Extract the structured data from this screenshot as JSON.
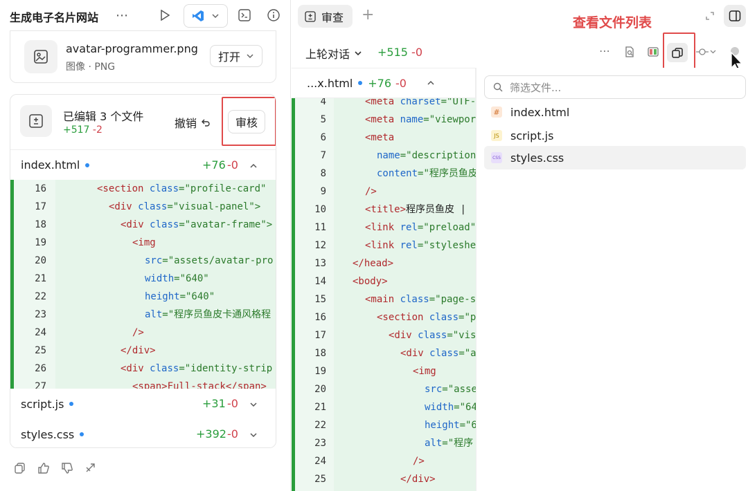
{
  "left": {
    "title": "生成电子名片网站",
    "image_card": {
      "filename": "avatar-programmer.png",
      "meta": "图像 · PNG",
      "open_label": "打开"
    },
    "edit_card": {
      "title": "已编辑 3 个文件",
      "added": "+517",
      "removed": "-2",
      "undo_label": "撤销",
      "review_label": "审核"
    },
    "files": [
      {
        "name": "index.html",
        "added": "+76",
        "removed": "-0"
      },
      {
        "name": "script.js",
        "added": "+31",
        "removed": "-0"
      },
      {
        "name": "styles.css",
        "added": "+392",
        "removed": "-0"
      }
    ],
    "code_lines": [
      {
        "n": "16",
        "indent": 3,
        "html": "section-profile"
      },
      {
        "n": "17"
      },
      {
        "n": "18"
      },
      {
        "n": "19"
      },
      {
        "n": "20"
      },
      {
        "n": "21"
      },
      {
        "n": "22"
      },
      {
        "n": "23"
      },
      {
        "n": "24"
      },
      {
        "n": "25"
      },
      {
        "n": "26"
      },
      {
        "n": "27"
      }
    ],
    "code_text": {
      "l16a": "<section ",
      "l16b": "class",
      "l16c": "=\"profile-card\"",
      "l17a": "<div ",
      "l17b": "class",
      "l17c": "=\"visual-panel\">",
      "l18a": "<div ",
      "l18b": "class",
      "l18c": "=\"avatar-frame\">",
      "l19a": "<img",
      "l20a": "src",
      "l20b": "=\"assets/avatar-pro",
      "l21a": "width",
      "l21b": "=\"640\"",
      "l22a": "height",
      "l22b": "=\"640\"",
      "l23a": "alt",
      "l23b": "=\"程序员鱼皮卡通风格程",
      "l24a": "/>",
      "l25a": "</div>",
      "l26a": "<div ",
      "l26b": "class",
      "l26c": "=\"identity-strip",
      "l27a": "<span>Full-stack</span>"
    }
  },
  "right": {
    "tab_label": "审查",
    "annotation": "查看文件列表",
    "round_label": "上轮对话",
    "added": "+515",
    "removed": "-0",
    "file_tab": {
      "name": "...x.html",
      "added": "+76",
      "removed": "-0"
    },
    "filter_placeholder": "筛选文件...",
    "files": [
      {
        "name": "index.html",
        "icon": "#"
      },
      {
        "name": "script.js",
        "icon": "JS"
      },
      {
        "name": "styles.css",
        "icon": "CSS"
      }
    ],
    "line_numbers": [
      "4",
      "5",
      "6",
      "7",
      "8",
      "9",
      "10",
      "11",
      "12",
      "13",
      "14",
      "15",
      "16",
      "17",
      "18",
      "19",
      "20",
      "21",
      "22",
      "23",
      "24",
      "25"
    ],
    "code": {
      "c4a": "<meta ",
      "c4b": "charset",
      "c4c": "=\"UTF-",
      "c5a": "<meta ",
      "c5b": "name",
      "c5c": "=\"viewpor",
      "c6a": "<meta",
      "c7a": "name",
      "c7b": "=\"description",
      "c8a": "content",
      "c8b": "=\"程序员鱼皮",
      "c9a": "/>",
      "c10a": "<title>",
      "c10b": "程序员鱼皮 |",
      "c11a": "<link ",
      "c11b": "rel",
      "c11c": "=\"preload\"",
      "c12a": "<link ",
      "c12b": "rel",
      "c12c": "=\"styleshe",
      "c13a": "</head>",
      "c14a": "<body>",
      "c15a": "<main ",
      "c15b": "class",
      "c15c": "=\"page-s",
      "c16a": "<section ",
      "c16b": "class",
      "c16c": "=\"p",
      "c17a": "<div ",
      "c17b": "class",
      "c17c": "=\"vis",
      "c18a": "<div ",
      "c18b": "class",
      "c18c": "=\"a",
      "c19a": "<img",
      "c20a": "src",
      "c20b": "=\"asse",
      "c21a": "width",
      "c21b": "=\"64",
      "c22a": "height",
      "c22b": "=\"6",
      "c23a": "alt",
      "c23b": "=\"程序",
      "c24a": "/>",
      "c25a": "</div>"
    }
  },
  "colors": {
    "added_green": "#2a9d3c",
    "removed_red": "#d0404a",
    "highlight_red": "#e04a4a",
    "diff_bg": "#e8f6ec",
    "dot_blue": "#2f8cf0"
  }
}
